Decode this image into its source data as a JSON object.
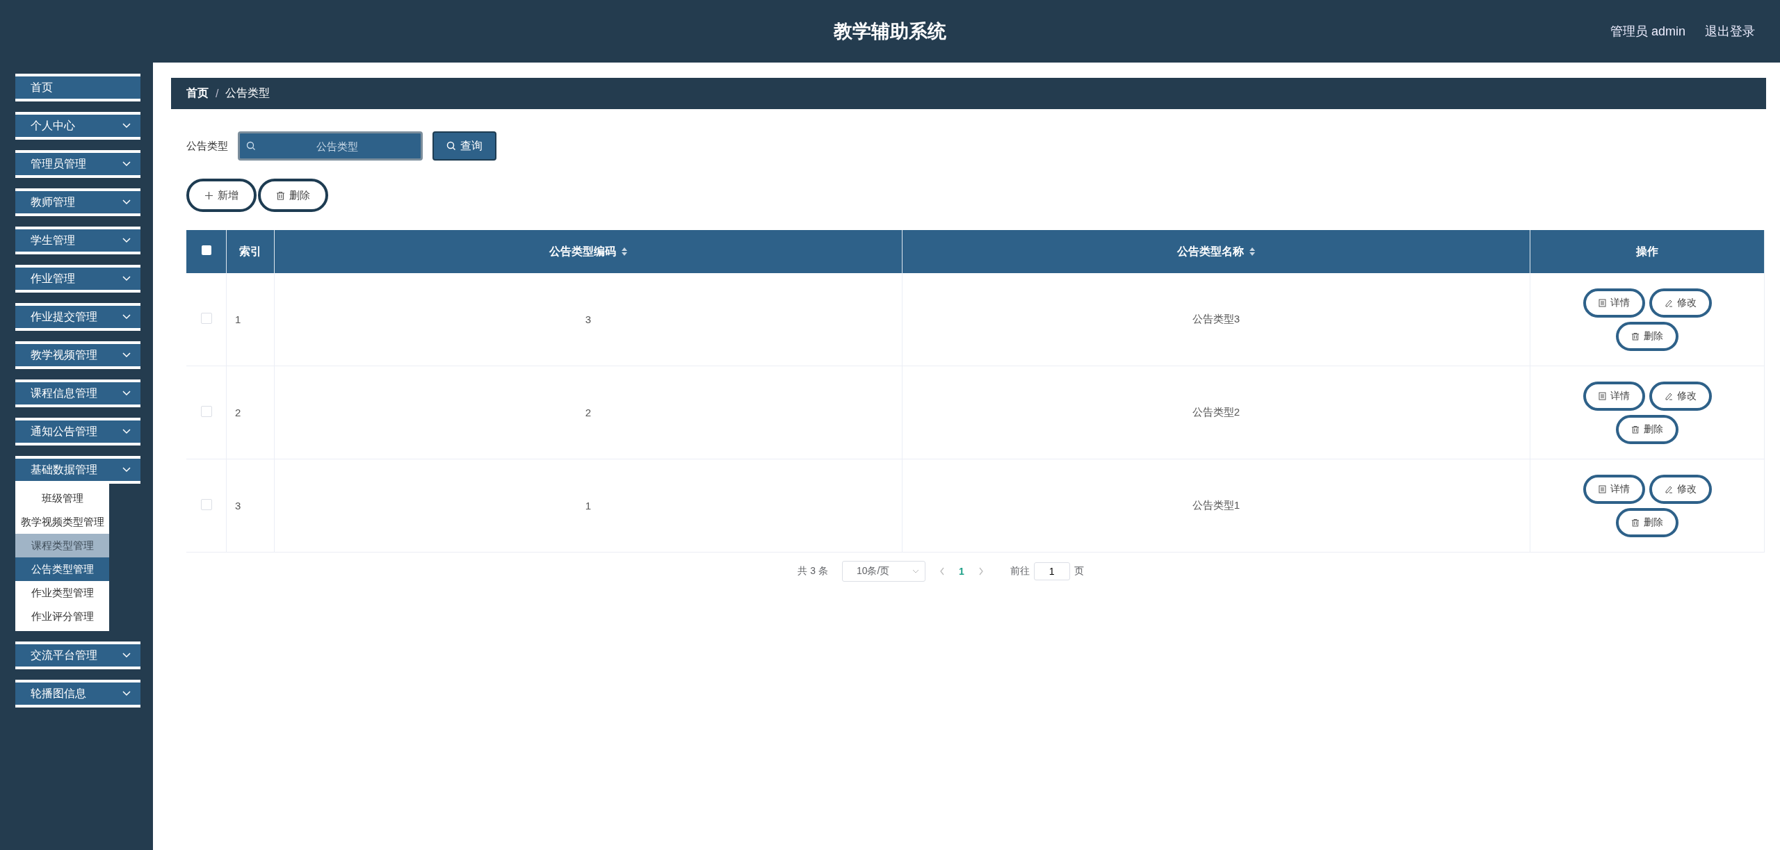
{
  "header": {
    "title": "教学辅助系统",
    "user": "管理员 admin",
    "logout": "退出登录"
  },
  "sidebar": {
    "items": [
      {
        "label": "首页",
        "kind": "link"
      },
      {
        "label": "个人中心",
        "kind": "group"
      },
      {
        "label": "管理员管理",
        "kind": "group"
      },
      {
        "label": "教师管理",
        "kind": "group"
      },
      {
        "label": "学生管理",
        "kind": "group"
      },
      {
        "label": "作业管理",
        "kind": "group"
      },
      {
        "label": "作业提交管理",
        "kind": "group"
      },
      {
        "label": "教学视频管理",
        "kind": "group"
      },
      {
        "label": "课程信息管理",
        "kind": "group"
      },
      {
        "label": "通知公告管理",
        "kind": "group"
      },
      {
        "label": "基础数据管理",
        "kind": "group",
        "children": [
          {
            "label": "班级管理",
            "selected": false,
            "hovered": false
          },
          {
            "label": "教学视频类型管理",
            "selected": false,
            "hovered": false
          },
          {
            "label": "课程类型管理",
            "selected": false,
            "hovered": true
          },
          {
            "label": "公告类型管理",
            "selected": true,
            "hovered": false
          },
          {
            "label": "作业类型管理",
            "selected": false,
            "hovered": false
          },
          {
            "label": "作业评分管理",
            "selected": false,
            "hovered": false
          }
        ]
      },
      {
        "label": "交流平台管理",
        "kind": "group"
      },
      {
        "label": "轮播图信息",
        "kind": "group"
      }
    ]
  },
  "breadcrumb": [
    {
      "label": "首页",
      "current": false
    },
    {
      "label": "公告类型",
      "current": true
    }
  ],
  "breadcrumb_separator": "/",
  "search": {
    "label": "公告类型",
    "placeholder": "公告类型",
    "button": "查询"
  },
  "actions": [
    {
      "label": "新增",
      "kind": "add"
    },
    {
      "label": "删除",
      "kind": "delete"
    }
  ],
  "table": {
    "select_all_checked": false,
    "columns": [
      {
        "label": "索引",
        "sortable": false
      },
      {
        "label": "公告类型编码",
        "sortable": true
      },
      {
        "label": "公告类型名称",
        "sortable": true
      },
      {
        "label": "操作",
        "sortable": false
      }
    ],
    "rows": [
      {
        "checked": false,
        "index": "1",
        "code": "3",
        "name": "公告类型3",
        "buttons": [
          {
            "label": "详情",
            "kind": "detail"
          },
          {
            "label": "修改",
            "kind": "edit"
          },
          {
            "label": "删除",
            "kind": "delete"
          }
        ]
      },
      {
        "checked": false,
        "index": "2",
        "code": "2",
        "name": "公告类型2",
        "buttons": [
          {
            "label": "详情",
            "kind": "detail"
          },
          {
            "label": "修改",
            "kind": "edit"
          },
          {
            "label": "删除",
            "kind": "delete"
          }
        ]
      },
      {
        "checked": false,
        "index": "3",
        "code": "1",
        "name": "公告类型1",
        "buttons": [
          {
            "label": "详情",
            "kind": "detail"
          },
          {
            "label": "修改",
            "kind": "edit"
          },
          {
            "label": "删除",
            "kind": "delete"
          }
        ]
      }
    ]
  },
  "pagination": {
    "total": "共 3 条",
    "page_size": "10条/页",
    "pages": [
      {
        "label": "1",
        "selected": true
      }
    ],
    "goto_label": "前往",
    "goto_value": "1",
    "goto_suffix": "页"
  }
}
